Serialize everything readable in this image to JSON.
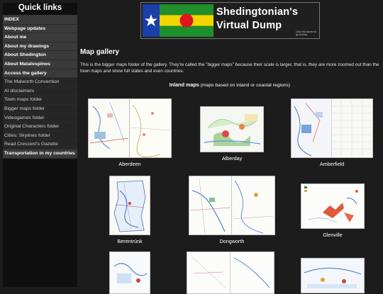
{
  "sidebar": {
    "title": "Quick links",
    "items": [
      {
        "label": "INDEX",
        "style": "bold"
      },
      {
        "label": "Webpage updates",
        "style": "bold"
      },
      {
        "label": "About me",
        "style": "bold"
      },
      {
        "label": "About my drawings",
        "style": "bold"
      },
      {
        "label": "About Shedington",
        "style": "bold"
      },
      {
        "label": "About Matalospinos",
        "style": "bold"
      },
      {
        "label": "Access the gallery",
        "style": "bold"
      },
      {
        "label": "The Malworth Convention",
        "style": "light"
      },
      {
        "label": "AI disclaimers",
        "style": "light"
      },
      {
        "label": "Town maps folder",
        "style": "light"
      },
      {
        "label": "Bigger maps folder",
        "style": "light"
      },
      {
        "label": "Videogames folder",
        "style": "light"
      },
      {
        "label": "Original Characters folder",
        "style": "light"
      },
      {
        "label": "Cities: Skylines folder",
        "style": "light"
      },
      {
        "label": "Read Crescent's Gazette",
        "style": "light"
      },
      {
        "label": "Transportation in my countries",
        "style": "bold"
      }
    ]
  },
  "banner": {
    "line1": "Shedingtonian's",
    "line2": "Virtual Dump",
    "hint": "Click this banner to go to index",
    "flag_colors": {
      "blue": "#1a3fa8",
      "yellow": "#f2d600",
      "green": "#1e8f2a",
      "red": "#e0141e"
    }
  },
  "main": {
    "heading": "Map gallery",
    "intro": "This is the bigger maps folder of the gallery. They're called the \"bigger maps\" because their scale is larger, that is, they are more zoomed out than the town maps and show full states and even countries.",
    "section_title": "Inland maps",
    "section_note": "(maps based on inland or coastal regions)",
    "maps": [
      {
        "name": "Aberdeen"
      },
      {
        "name": "Alberday"
      },
      {
        "name": "Amberfield"
      },
      {
        "name": "Berentrünk"
      },
      {
        "name": "Dongworth"
      },
      {
        "name": "Glenville"
      }
    ]
  }
}
